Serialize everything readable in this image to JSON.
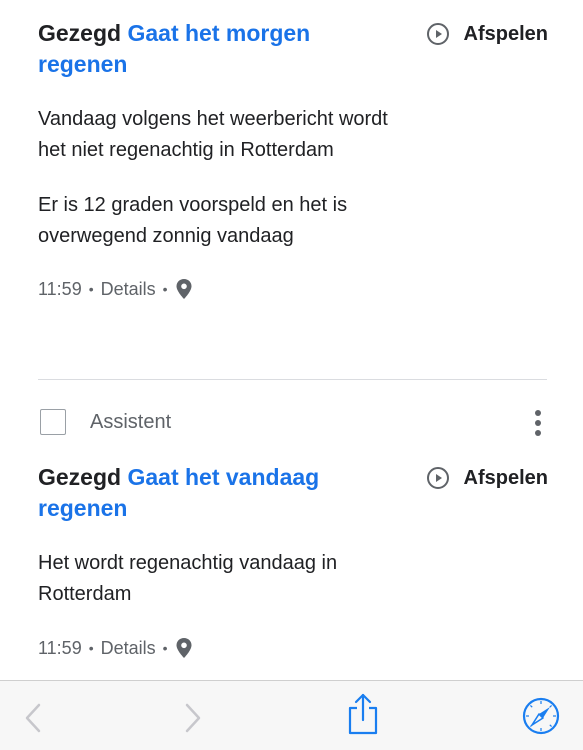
{
  "entries": [
    {
      "said_prefix": "Gezegd",
      "query": "Gaat het morgen regenen",
      "play_label": "Afspelen",
      "answers": [
        "Vandaag volgens het weerbericht wordt het niet regenachtig in Rotterdam",
        "Er is 12 graden voorspeld en het is overwegend zonnig vandaag"
      ],
      "time": "11:59",
      "details_label": "Details"
    },
    {
      "said_prefix": "Gezegd",
      "query": "Gaat het vandaag regenen",
      "play_label": "Afspelen",
      "answers": [
        "Het wordt regenachtig vandaag in Rotterdam"
      ],
      "time": "11:59",
      "details_label": "Details"
    }
  ],
  "assistant_row": {
    "label": "Assistent"
  },
  "colors": {
    "accent": "#1a73e8",
    "toolbar_accent": "#1a7ef0",
    "disabled": "#c7c7cc"
  },
  "toolbar": {
    "icons": [
      "back-arrow-icon",
      "forward-arrow-icon",
      "share-icon",
      "safari-compass-icon"
    ]
  }
}
